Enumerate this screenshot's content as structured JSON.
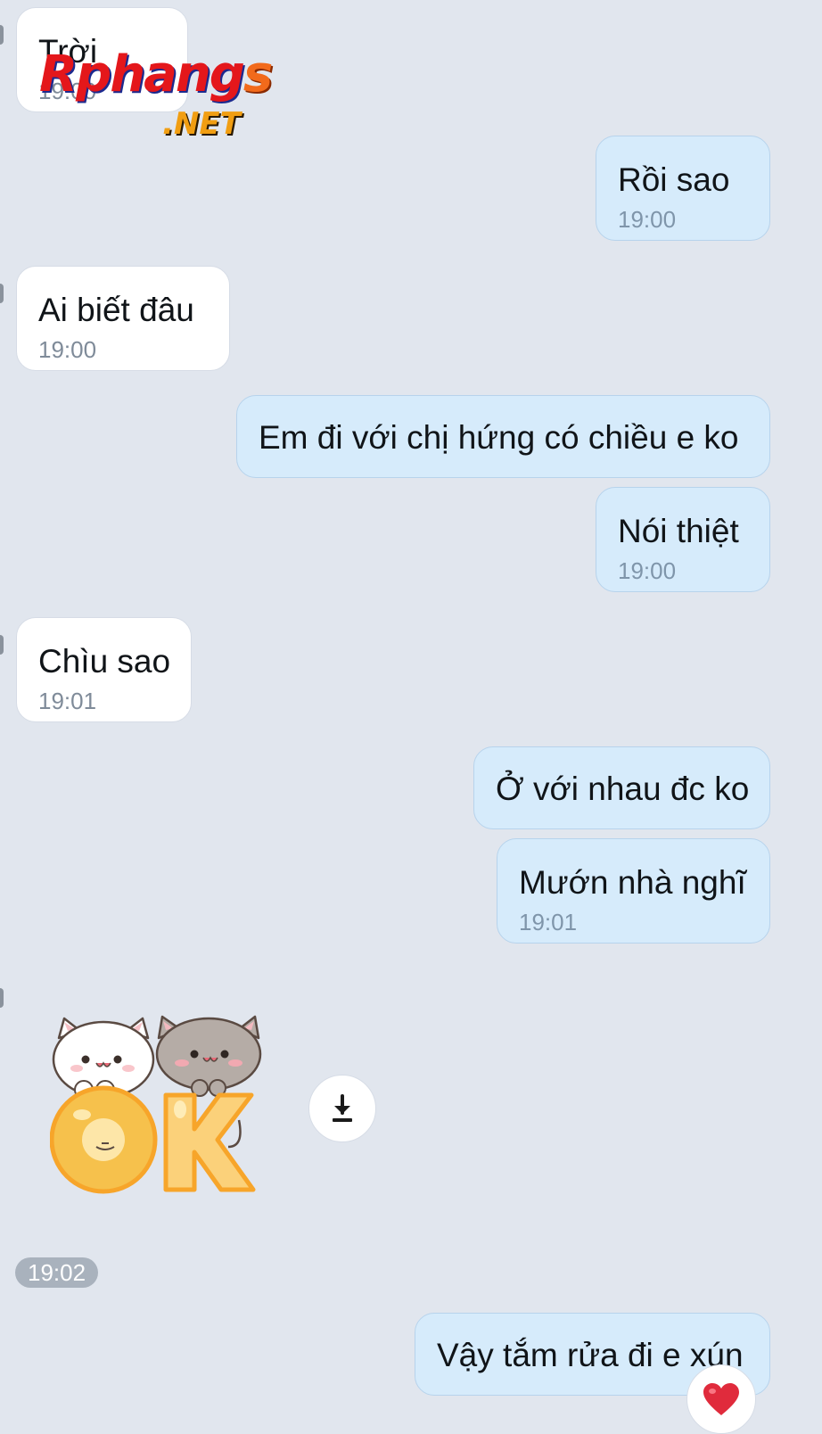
{
  "messages": [
    {
      "direction": "incoming",
      "text": "Trời",
      "time": "19:00"
    },
    {
      "direction": "outgoing",
      "text": "Rồi sao",
      "time": "19:00"
    },
    {
      "direction": "incoming",
      "text": "Ai biết đâu",
      "time": "19:00"
    },
    {
      "direction": "outgoing",
      "text": "Em đi với chị hứng có chiều e ko"
    },
    {
      "direction": "outgoing",
      "text": "Nói thiệt",
      "time": "19:00"
    },
    {
      "direction": "incoming",
      "text": "Chìu sao",
      "time": "19:01"
    },
    {
      "direction": "outgoing",
      "text": "Ở với nhau đc ko"
    },
    {
      "direction": "outgoing",
      "text": "Mướn nhà nghĩ",
      "time": "19:01"
    },
    {
      "direction": "incoming",
      "type": "sticker",
      "sticker_text": "OK",
      "time": "19:02"
    },
    {
      "direction": "outgoing",
      "text": "Vậy tắm rửa đi e xún",
      "reaction": "heart-icon"
    }
  ],
  "watermark": {
    "main": "Rphang",
    "suffix": "s",
    "domain": ".NET"
  },
  "colors": {
    "background": "#e1e6ee",
    "incoming_bubble": "#ffffff",
    "outgoing_bubble": "#d6ebfb",
    "time_text": "#7f8b99",
    "reaction_heart": "#e02b3c",
    "watermark_red": "#e4171b",
    "watermark_orange": "#f26a1b"
  },
  "icons": {
    "download": "download-icon",
    "reaction": "heart-icon"
  }
}
